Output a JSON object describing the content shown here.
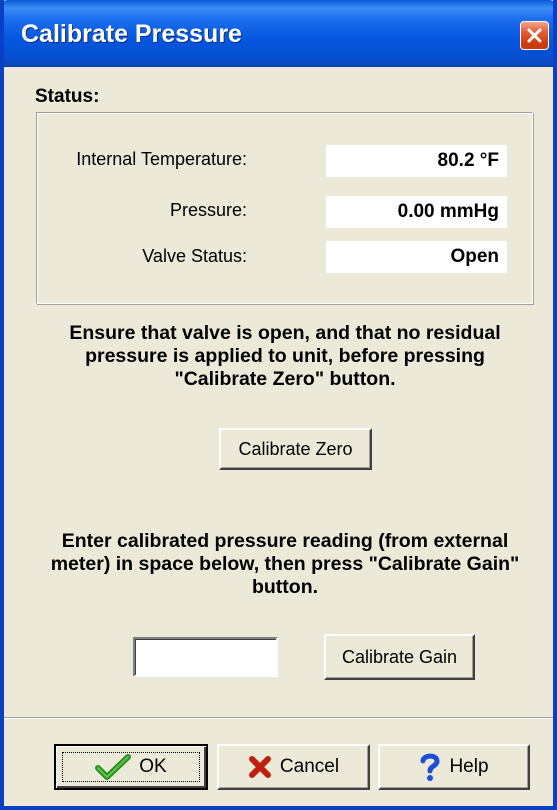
{
  "window": {
    "title": "Calibrate Pressure"
  },
  "status": {
    "heading": "Status:",
    "rows": [
      {
        "label": "Internal Temperature:",
        "value": "80.2 °F"
      },
      {
        "label": "Pressure:",
        "value": "0.00 mmHg"
      },
      {
        "label": "Valve Status:",
        "value": "Open"
      }
    ]
  },
  "zero": {
    "instruction": "Ensure that valve is open, and that no residual pressure is applied to unit, before pressing \"Calibrate Zero\" button.",
    "button_label": "Calibrate Zero"
  },
  "gain": {
    "instruction": "Enter calibrated pressure reading (from external meter) in space below, then press \"Calibrate Gain\" button.",
    "input_value": "",
    "button_label": "Calibrate Gain"
  },
  "footer": {
    "ok_label": "OK",
    "cancel_label": "Cancel",
    "help_label": "Help"
  },
  "colors": {
    "titlebar": "#0757e0",
    "window_bg": "#ece9d8",
    "ok_icon": "#2a8f1f",
    "cancel_icon": "#c0200d",
    "help_icon": "#1c4fd6"
  },
  "icons": {
    "close": "close-icon",
    "ok": "checkmark-icon",
    "cancel": "x-mark-icon",
    "help": "question-mark-icon"
  }
}
